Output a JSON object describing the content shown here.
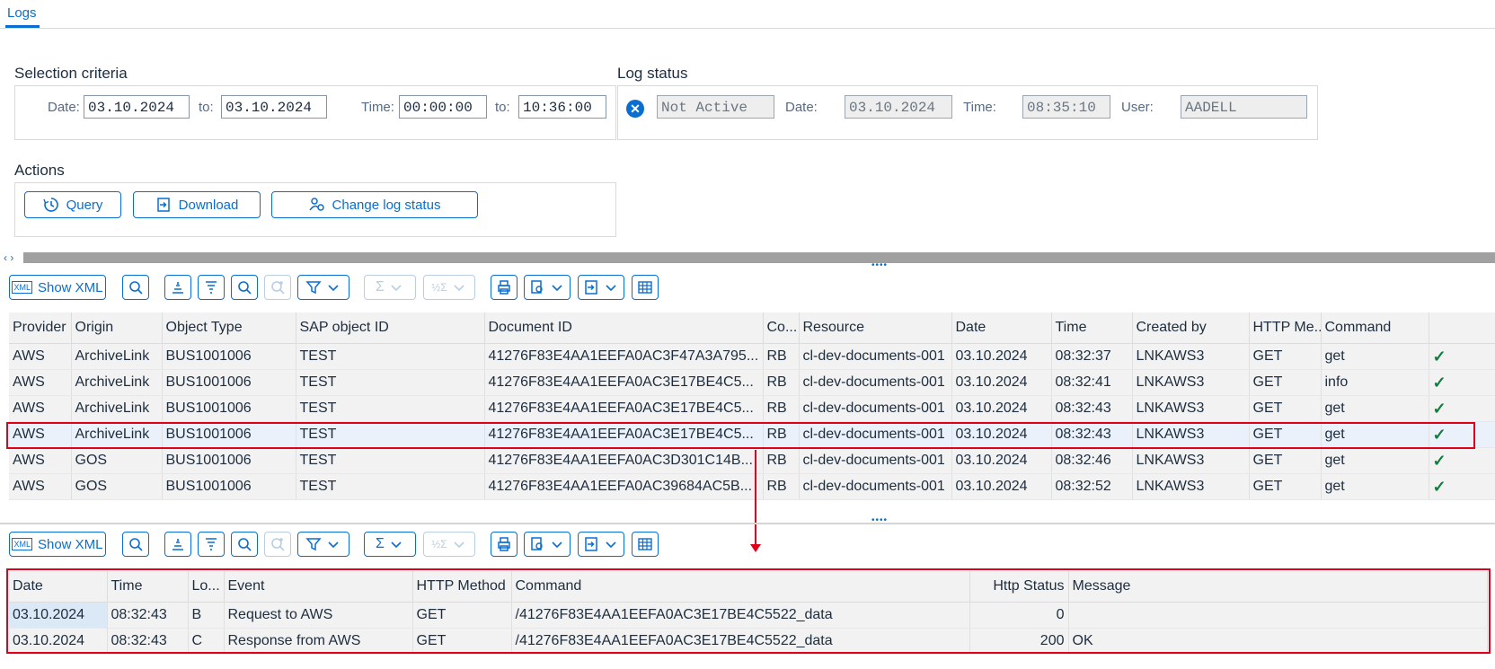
{
  "tab": {
    "label": "Logs"
  },
  "selection": {
    "title": "Selection criteria",
    "date_label": "Date:",
    "date_from": "03.10.2024",
    "to_label": "to:",
    "date_to": "03.10.2024",
    "time_label": "Time:",
    "time_from": "00:00:00",
    "time_to": "10:36:00"
  },
  "log_status": {
    "title": "Log status",
    "status": "Not Active",
    "date_label": "Date:",
    "date": "03.10.2024",
    "time_label": "Time:",
    "time": "08:35:10",
    "user_label": "User:",
    "user": "AADELL"
  },
  "actions": {
    "title": "Actions",
    "query": "Query",
    "download": "Download",
    "change_log_status": "Change log status"
  },
  "toolbar": {
    "show_xml": "Show XML"
  },
  "table1": {
    "headers": [
      "Provider",
      "Origin",
      "Object Type",
      "SAP object ID",
      "Document ID",
      "Co...",
      "Resource",
      "Date",
      "Time",
      "Created by",
      "HTTP Me...",
      "Command",
      ""
    ],
    "rows": [
      [
        "AWS",
        "ArchiveLink",
        "BUS1001006",
        "TEST",
        "41276F83E4AA1EEFA0AC3F47A3A795...",
        "RB",
        "cl-dev-documents-001",
        "03.10.2024",
        "08:32:37",
        "LNKAWS3",
        "GET",
        "get"
      ],
      [
        "AWS",
        "ArchiveLink",
        "BUS1001006",
        "TEST",
        "41276F83E4AA1EEFA0AC3E17BE4C5...",
        "RB",
        "cl-dev-documents-001",
        "03.10.2024",
        "08:32:41",
        "LNKAWS3",
        "GET",
        "info"
      ],
      [
        "AWS",
        "ArchiveLink",
        "BUS1001006",
        "TEST",
        "41276F83E4AA1EEFA0AC3E17BE4C5...",
        "RB",
        "cl-dev-documents-001",
        "03.10.2024",
        "08:32:43",
        "LNKAWS3",
        "GET",
        "get"
      ],
      [
        "AWS",
        "ArchiveLink",
        "BUS1001006",
        "TEST",
        "41276F83E4AA1EEFA0AC3E17BE4C5...",
        "RB",
        "cl-dev-documents-001",
        "03.10.2024",
        "08:32:43",
        "LNKAWS3",
        "GET",
        "get"
      ],
      [
        "AWS",
        "GOS",
        "BUS1001006",
        "TEST",
        "41276F83E4AA1EEFA0AC3D301C14B...",
        "RB",
        "cl-dev-documents-001",
        "03.10.2024",
        "08:32:46",
        "LNKAWS3",
        "GET",
        "get"
      ],
      [
        "AWS",
        "GOS",
        "BUS1001006",
        "TEST",
        "41276F83E4AA1EEFA0AC39684AC5B...",
        "RB",
        "cl-dev-documents-001",
        "03.10.2024",
        "08:32:52",
        "LNKAWS3",
        "GET",
        "get"
      ]
    ],
    "selected_row": 3
  },
  "table2": {
    "headers": [
      "Date",
      "Time",
      "Lo...",
      "Event",
      "HTTP Method",
      "Command",
      "Http Status",
      "Message"
    ],
    "rows": [
      [
        "03.10.2024",
        "08:32:43",
        "B",
        "Request to AWS",
        "GET",
        "/41276F83E4AA1EEFA0AC3E17BE4C5522_data",
        "0",
        ""
      ],
      [
        "03.10.2024",
        "08:32:43",
        "C",
        "Response from AWS",
        "GET",
        "/41276F83E4AA1EEFA0AC3E17BE4C5522_data",
        "200",
        "OK"
      ]
    ]
  },
  "colors": {
    "accent": "#0a6ed1",
    "highlight": "#e0001a",
    "success": "#107e3e",
    "error": "#0a6ed1"
  }
}
